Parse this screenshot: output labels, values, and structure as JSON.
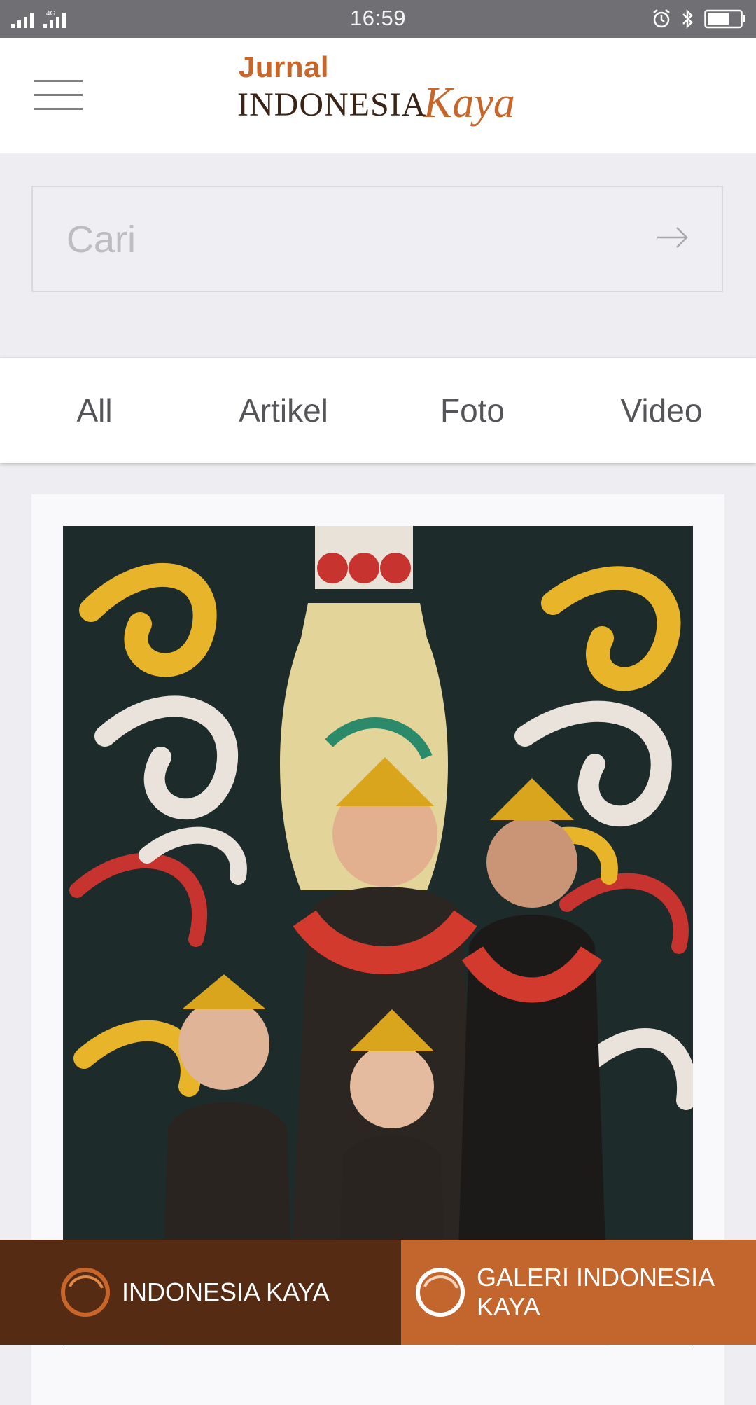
{
  "status_bar": {
    "time": "16:59",
    "network_label": "4G",
    "icons": [
      "signal-icon",
      "alarm-icon",
      "bluetooth-icon",
      "battery-icon"
    ]
  },
  "header": {
    "logo_line1": "Jurnal",
    "logo_line2": "INDONESIA",
    "logo_line3": "Kaya"
  },
  "search": {
    "placeholder": "Cari",
    "value": ""
  },
  "tabs": [
    {
      "label": "All"
    },
    {
      "label": "Artikel"
    },
    {
      "label": "Foto"
    },
    {
      "label": "Video"
    }
  ],
  "bottom_nav": {
    "left_label": "INDONESIA KAYA",
    "right_label": "GALERI INDONESIA KAYA"
  },
  "colors": {
    "brand_orange": "#c8662a",
    "brand_brown": "#552b14",
    "header_bg": "#ffffff",
    "page_bg": "#eeedf1"
  }
}
